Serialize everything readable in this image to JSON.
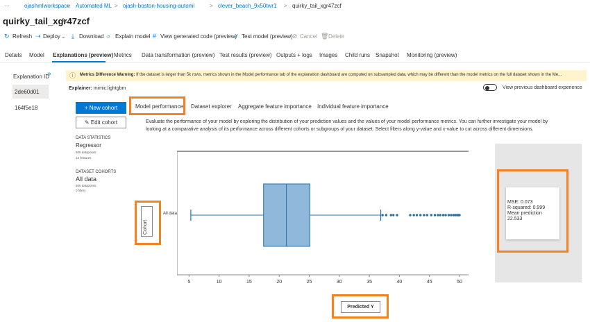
{
  "breadcrumb": {
    "ellipsis": "···",
    "items": [
      "ojashmlworkspace",
      "Automated ML",
      "ojash-boston-housing-automl",
      "clever_beach_9x50twr1",
      "quirky_tail_xgr47zcf"
    ],
    "separator": ">"
  },
  "page_title": "quirky_tail_xgr47zcf",
  "toolbar": {
    "refresh": "Refresh",
    "deploy": "Deploy",
    "download": "Download",
    "explain_model": "Explain model",
    "view_code": "View generated code (preview)",
    "test_model": "Test model (preview)",
    "cancel": "Cancel",
    "delete": "Delete"
  },
  "tabs": [
    "Details",
    "Model",
    "Explanations (preview)",
    "Metrics",
    "Data transformation (preview)",
    "Test results (preview)",
    "Outputs + logs",
    "Images",
    "Child runs",
    "Snapshot",
    "Monitoring (preview)"
  ],
  "left_panel": {
    "heading": "Explanation ID",
    "items": [
      "2de60d01",
      "164f5e18"
    ]
  },
  "warning": {
    "title": "Metrics Difference Warning:",
    "text": "If the dataset is larger than 5k rows, metrics shown in the Model performance tab of the explanation dashboard are computed on subsampled data, which may be different than the model metrics on the full dataset shown in the Me..."
  },
  "explainer": {
    "label": "Explainer:",
    "value": "mimic.lightgbm"
  },
  "toggle_label": "View previous dashboard experience",
  "buttons": {
    "new_cohort": "New cohort",
    "edit_cohort": "Edit cohort"
  },
  "sub_tabs": [
    "Model performance",
    "Dataset explorer",
    "Aggregate feature importance",
    "Individual feature importance"
  ],
  "description": "Evaluate the performance of your model by exploring the distribution of your prediction values and the values of your model performance metrics. You can further investigate your model by looking at a comparative analysis of its performance across different cohorts or subgroups of your dataset. Select filters along y-value and x-value to cut across different dimensions.",
  "data_statistics": {
    "heading": "DATA STATISTICS",
    "type": "Regressor",
    "datapoints": "506 datapoints",
    "features": "13 features"
  },
  "dataset_cohorts": {
    "heading": "DATASET COHORTS",
    "name": "All data",
    "datapoints": "506 datapoints",
    "filters": "0 filters"
  },
  "cohort_button": "Cohort",
  "x_axis_button": "Predicted Y",
  "metrics": {
    "mse": "MSE: 0.073",
    "r_squared": "R-squared: 0.999",
    "mean_prediction_label": "Mean prediction",
    "mean_prediction_value": "22.533"
  },
  "colors": {
    "accent": "#0078d4",
    "highlight": "#f58220",
    "box_fill": "#8fb8da",
    "box_stroke": "#2a6fa8"
  },
  "chart_data": {
    "type": "box",
    "category": "All data",
    "x_ticks": [
      5,
      10,
      15,
      20,
      25,
      30,
      35,
      40,
      45,
      50
    ],
    "xlim": [
      3,
      51.5
    ],
    "whisker_low": 5.3,
    "q1": 17.4,
    "median": 21.2,
    "q3": 25.1,
    "whisker_high": 36.9,
    "outliers": [
      37.2,
      37.8,
      38.6,
      39.0,
      39.6,
      41.8,
      42.4,
      42.9,
      43.5,
      44.1,
      44.6,
      45.3,
      45.9,
      46.4,
      46.8,
      47.3,
      47.7,
      48.2,
      48.6,
      49.0,
      49.3,
      49.6,
      49.8,
      50.0
    ]
  }
}
